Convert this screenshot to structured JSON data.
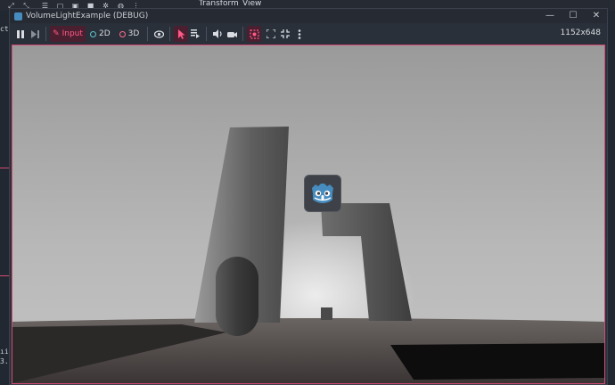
{
  "editor": {
    "menus": [
      "Transform",
      "View"
    ],
    "console_chars": [
      "ctı",
      "ıin",
      "3."
    ]
  },
  "window": {
    "title": "VolumeLightExample (DEBUG)",
    "controls": [
      "minimize-icon",
      "maximize-icon",
      "close-icon"
    ]
  },
  "toolbar": {
    "input_label": "Input",
    "mode_2d_label": "2D",
    "mode_3d_label": "3D",
    "resolution": "1152x648",
    "icons": [
      "pause-icon",
      "step-icon",
      "pin-icon",
      "eye-icon",
      "pointer-icon",
      "list-icon",
      "speaker-icon",
      "camera-icon",
      "camera-override-icon",
      "expand-icon",
      "fullscreen-icon",
      "more-icon"
    ]
  },
  "colors": {
    "accent": "#ff5a87",
    "mode_2d_ring": "#5ec5cf",
    "mode_3d_ring": "#ff6c8a",
    "viewport_border": "#d44a74"
  }
}
